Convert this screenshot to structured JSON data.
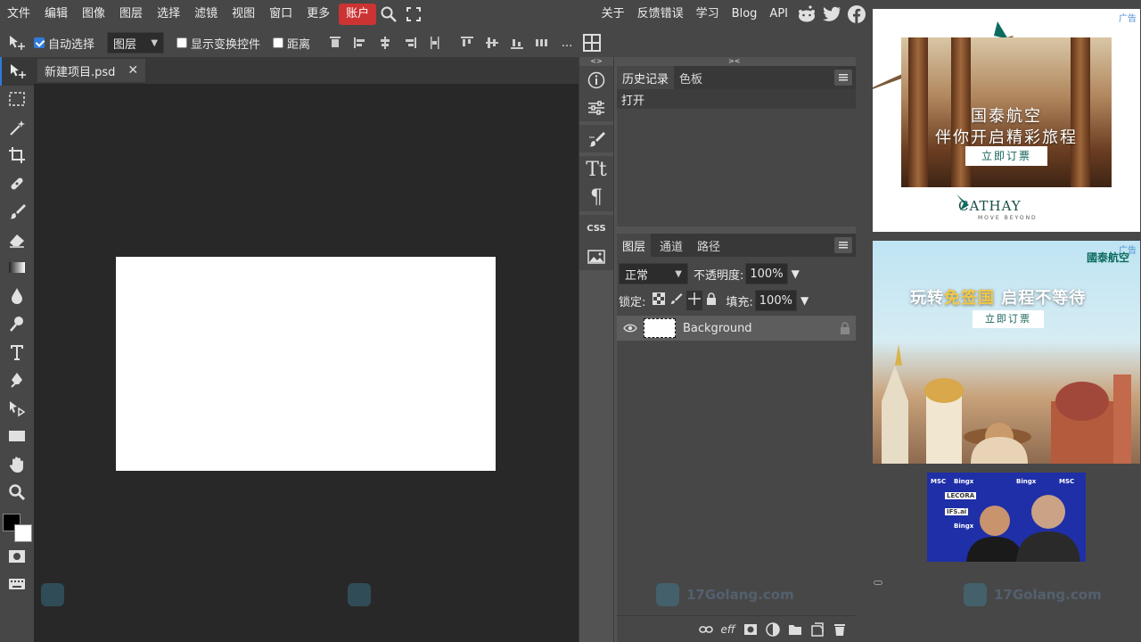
{
  "menu": {
    "items": [
      "文件",
      "编辑",
      "图像",
      "图层",
      "选择",
      "滤镜",
      "视图",
      "窗口",
      "更多"
    ],
    "account": "账户",
    "right_items": [
      "关于",
      "反馈错误",
      "学习",
      "Blog",
      "API"
    ]
  },
  "options": {
    "auto_select_label": "自动选择",
    "auto_select_checked": true,
    "target_select": "图层",
    "transform_label": "显示变换控件",
    "distance_label": "距离",
    "more": "..."
  },
  "document": {
    "tab_title": "新建项目.psd",
    "canvas_color": "#ffffff"
  },
  "icon_column": {
    "arrows_left": "<>",
    "arrows_right": "><",
    "css_label": "CSS"
  },
  "history_panel": {
    "tabs": [
      "历史记录",
      "色板"
    ],
    "entries": [
      "打开"
    ]
  },
  "layers_panel": {
    "tabs": [
      "图层",
      "通道",
      "路径"
    ],
    "blend_mode": "正常",
    "opacity_label": "不透明度:",
    "opacity_value": "100%",
    "lock_label": "锁定:",
    "fill_label": "填充:",
    "fill_value": "100%",
    "layers": [
      {
        "name": "Background",
        "visible": true,
        "locked": true
      }
    ],
    "footer_eff": "eff"
  },
  "ads": {
    "label": "广告",
    "ad1": {
      "title1": "国泰航空",
      "title2": "伴你开启精彩旅程",
      "button": "立即订票",
      "brand": "CATHAY",
      "tagline": "MOVE BEYOND"
    },
    "ad2": {
      "brand": "國泰航空",
      "headline_a": "玩转",
      "headline_b": "免签国",
      "headline_c": " 启程不等待",
      "button": "立即订票"
    },
    "ad3": {
      "sponsor1": "Bingx",
      "sponsor2": "MSC",
      "sponsor3": "LECORA",
      "sponsor4": "IFS.ai"
    }
  },
  "watermark": {
    "text": "17Golang.com"
  },
  "colors": {
    "accent": "#2f7bdc",
    "account": "#cc3333",
    "foreground": "#000000",
    "background": "#ffffff"
  }
}
